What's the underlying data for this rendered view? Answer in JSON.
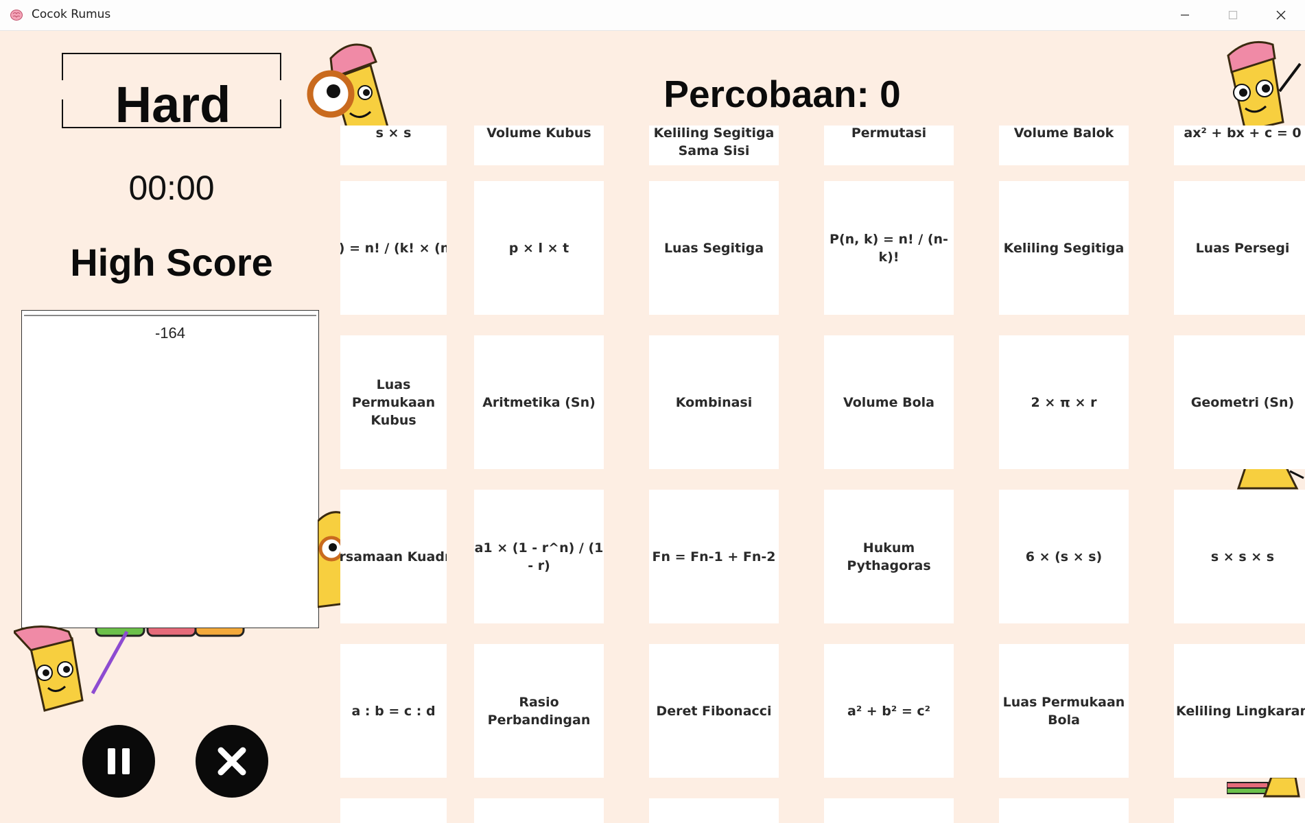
{
  "window": {
    "title": "Cocok Rumus"
  },
  "game": {
    "difficulty": "Hard",
    "timer": "00:00",
    "attempts": "Percobaan: 0",
    "high_score_title": "High Score",
    "high_scores": [
      "-164"
    ]
  },
  "cards": [
    {
      "text": "s × s"
    },
    {
      "text": "Volume Kubus"
    },
    {
      "text": "Keliling Segitiga Sama Sisi"
    },
    {
      "text": "Permutasi"
    },
    {
      "text": "Volume Balok"
    },
    {
      "text": "ax² + bx + c = 0"
    },
    {
      "text": "(n, k) = n! / (k! × (n-k)!)"
    },
    {
      "text": "p × l × t"
    },
    {
      "text": "Luas Segitiga"
    },
    {
      "text": "P(n, k) = n! / (n-k)!"
    },
    {
      "text": "Keliling Segitiga"
    },
    {
      "text": "Luas Persegi"
    },
    {
      "text": "Luas Permukaan Kubus"
    },
    {
      "text": "Aritmetika (Sn)"
    },
    {
      "text": "Kombinasi"
    },
    {
      "text": "Volume Bola"
    },
    {
      "text": "2 × π × r"
    },
    {
      "text": "Geometri (Sn)"
    },
    {
      "text": "Persamaan Kuadrat"
    },
    {
      "text": "a1 × (1 - r^n) / (1 - r)"
    },
    {
      "text": "Fn = Fn-1 + Fn-2"
    },
    {
      "text": "Hukum Pythagoras"
    },
    {
      "text": "6 × (s × s)"
    },
    {
      "text": "s × s × s"
    },
    {
      "text": "a : b = c : d"
    },
    {
      "text": "Rasio Perbandingan"
    },
    {
      "text": "Deret Fibonacci"
    },
    {
      "text": "a² + b² = c²"
    },
    {
      "text": "Luas Permukaan Bola"
    },
    {
      "text": "Keliling Lingkaran"
    },
    {
      "text": ""
    },
    {
      "text": ""
    },
    {
      "text": ""
    },
    {
      "text": ""
    },
    {
      "text": ""
    },
    {
      "text": ""
    }
  ],
  "icons": {
    "app": "brain-icon",
    "minimize": "minimize-icon",
    "maximize": "maximize-icon",
    "close": "close-icon",
    "pause": "pause-icon",
    "exit": "x-icon",
    "mascot": "pencil-mascot-icon"
  },
  "colors": {
    "background": "#fdeee3",
    "card": "#ffffff",
    "button": "#0a0a0a",
    "pencil": "#f7cf3f",
    "eraser": "#f08aa6"
  }
}
